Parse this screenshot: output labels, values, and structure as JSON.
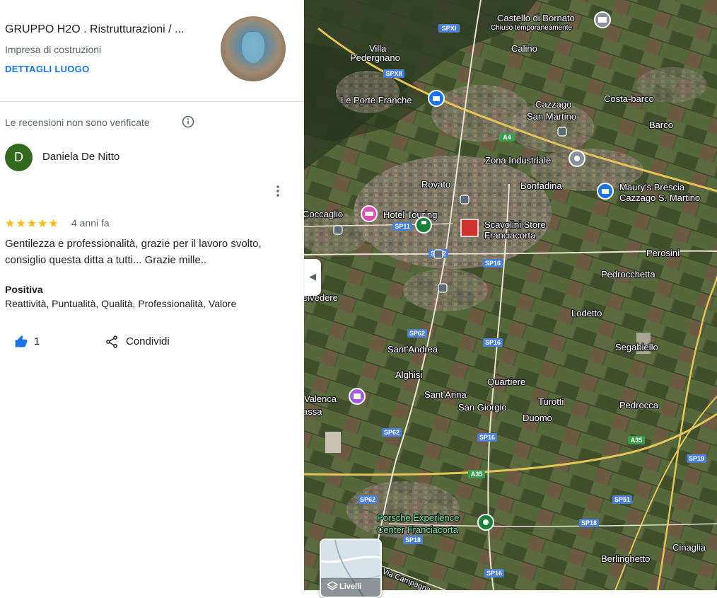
{
  "business": {
    "title": "GRUPPO H2O . Ristrutturazioni / ...",
    "category": "Impresa di costruzioni",
    "details_link": "DETTAGLI LUOGO"
  },
  "reviews": {
    "unverified_notice": "Le recensioni non sono verificate",
    "review": {
      "avatar_initial": "D",
      "reviewer": "Daniela De Nitto",
      "stars": "★★★★★",
      "rating": 5,
      "age": "4 anni fa",
      "text": "Gentilezza e professionalità, grazie per il lavoro svolto, consiglio questa ditta a tutti... Grazie mille..",
      "positive_title": "Positiva",
      "positive_tags": "Reattività, Puntualità, Qualità, Professionalità, Valore",
      "likes": "1",
      "share_label": "Condividi"
    }
  },
  "map": {
    "places": [
      "Castello di Bornato",
      "Chiuso temporaneamente",
      "Villa",
      "Pedergnano",
      "Calino",
      "Le Porte Franche",
      "Cazzago",
      "San Martino",
      "Costa-barco",
      "Barco",
      "Zona Industriale",
      "Rovato",
      "Bonfadina",
      "Maury's Brescia",
      "Cazzago S. Martino",
      "Coccaglio",
      "Hotel Touring",
      "Scavolini Store",
      "Franciacorta",
      "Perosini",
      "Pedrocchetta",
      "elvedere",
      "Lodetto",
      "Sant'Andrea",
      "Segabiello",
      "Alghisi",
      "Quartiere",
      "Valenca",
      "assa",
      "Sant'Anna",
      "Turotti",
      "San Giorgio",
      "Duomo",
      "Pedrocca",
      "Porsche Experience",
      "Center Franciacorta",
      "Berlinghetto",
      "Cinaglia",
      "Via Campagna"
    ],
    "roads": [
      "SPXI",
      "SPXII",
      "A4",
      "SP11",
      "SP62",
      "SP16",
      "SP62",
      "SP16",
      "SP62",
      "SP16",
      "A35",
      "A35",
      "SP19",
      "SP62",
      "SP51",
      "SP18",
      "SP18",
      "SP16"
    ],
    "layers_label": "Livelli",
    "collapse_icon": "chevron-left-icon"
  },
  "colors": {
    "accent": "#1a73e8",
    "star": "#fbbc04",
    "avatar": "#33691e",
    "like": "#1a73e8"
  }
}
